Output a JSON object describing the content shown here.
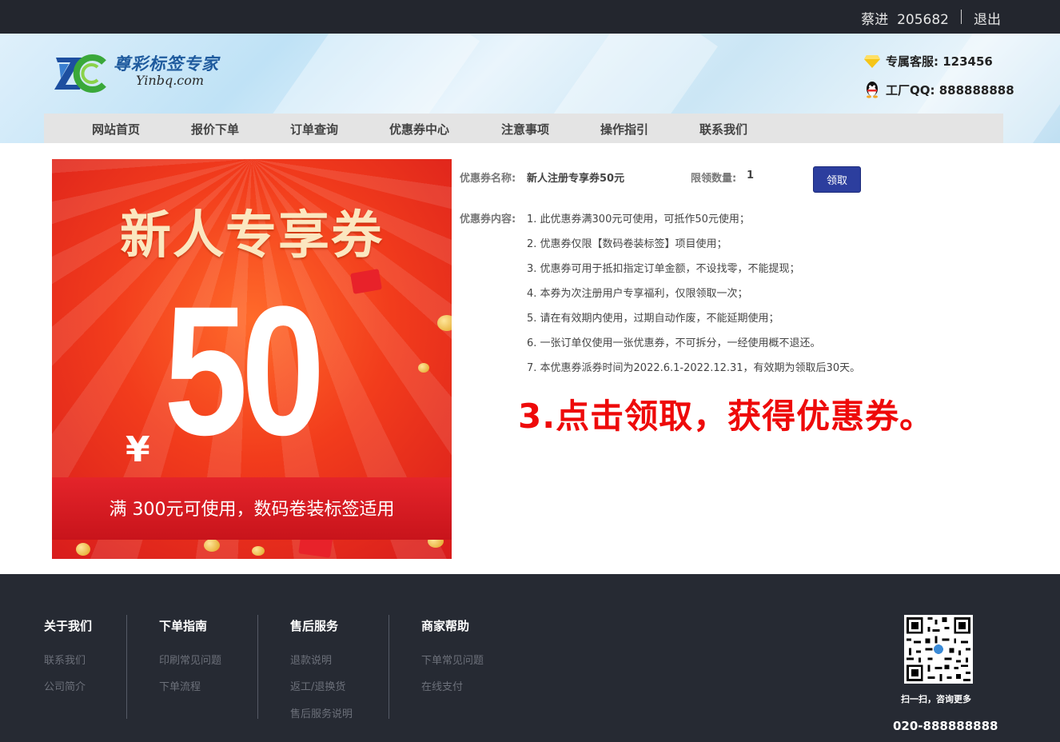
{
  "topbar": {
    "username": "蔡进",
    "user_id": "205682",
    "logout_label": "退出"
  },
  "brand": {
    "name": "尊彩标签专家",
    "domain": "Yinbq.com",
    "logo_letters": "ZC"
  },
  "contacts": {
    "service": "专属客服: 123456",
    "qq": "工厂QQ: 888888888"
  },
  "nav": [
    "网站首页",
    "报价下单",
    "订单查询",
    "优惠券中心",
    "注意事项",
    "操作指引",
    "联系我们"
  ],
  "coupon_image": {
    "title": "新人专享券",
    "currency": "¥",
    "amount": "50",
    "ribbon_text": "满 300元可使用，数码卷装标签适用"
  },
  "coupon_info": {
    "name_label": "优惠券名称:",
    "name_value": "新人注册专享券50元",
    "limit_label": "限领数量:",
    "limit_value": "1",
    "claim_button": "领取",
    "content_label": "优惠券内容:",
    "rules": [
      "1. 此优惠券满300元可使用，可抵作50元使用；",
      "2. 优惠券仅限【数码卷装标签】项目使用；",
      "3. 优惠券可用于抵扣指定订单金额，不设找零，不能提现；",
      "4. 本券为次注册用户专享福利，仅限领取一次；",
      "5. 请在有效期内使用，过期自动作废，不能延期使用；",
      "6. 一张订单仅使用一张优惠券，不可拆分，一经使用概不退还。",
      "7. 本优惠券派券时间为2022.6.1-2022.12.31，有效期为领取后30天。"
    ]
  },
  "instruction": "3.点击领取，获得优惠券。",
  "footer": {
    "columns": [
      {
        "title": "关于我们",
        "links": [
          "联系我们",
          "公司简介"
        ]
      },
      {
        "title": "下单指南",
        "links": [
          "印刷常见问题",
          "下单流程"
        ]
      },
      {
        "title": "售后服务",
        "links": [
          "退款说明",
          "返工/退换货",
          "售后服务说明"
        ]
      },
      {
        "title": "商家帮助",
        "links": [
          "下单常见问题",
          "在线支付"
        ]
      }
    ],
    "qr_caption": "扫一扫，咨询更多",
    "phone": "020-888888888"
  },
  "colors": {
    "topbar": "#23262e",
    "footer": "#262a33",
    "accent_red": "#ee0a0a",
    "button_blue": "#2c3e9e"
  }
}
